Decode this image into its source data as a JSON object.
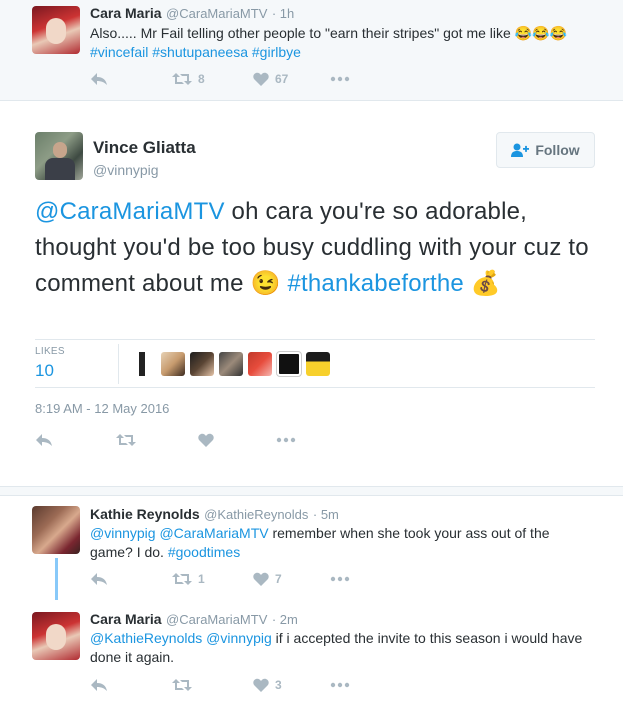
{
  "top_tweet": {
    "name": "Cara Maria",
    "handle": "@CaraMariaMTV",
    "time": "· 1h",
    "text": "Also..... Mr Fail telling other people to \"earn their stripes\" got me like 😂😂😂",
    "hashtags": "#vincefail #shutupaneesa #girlbye",
    "retweets": "8",
    "likes": "67"
  },
  "main_tweet": {
    "name": "Vince Gliatta",
    "handle": "@vinnypig",
    "follow_label": "Follow",
    "mention": "@CaraMariaMTV",
    "text_1": " oh cara you're so adorable, thought you'd be too busy cuddling with your cuz to comment about me ",
    "emoji_wink": "😉",
    "hashtag": "#thankabeforthe",
    "emoji_money": "💰",
    "likes_label": "LIKES",
    "likes_count": "10",
    "timestamp": "8:19 AM - 12 May 2016"
  },
  "reply1": {
    "name": "Kathie Reynolds",
    "handle": "@KathieReynolds",
    "time": "· 5m",
    "mention_1": "@vinnypig",
    "mention_2": "@CaraMariaMTV",
    "text": " remember when she took your ass out of the game? I do. ",
    "hashtag": "#goodtimes",
    "retweets": "1",
    "likes": "7"
  },
  "reply2": {
    "name": "Cara Maria",
    "handle": "@CaraMariaMTV",
    "time": "· 2m",
    "mention_1": "@KathieReynolds",
    "mention_2": "@vinnypig",
    "text": " if i accepted the invite to this season i would have done it again.",
    "likes": "3"
  },
  "colors": {
    "link": "#1b95e0",
    "icon": "#aab8c2",
    "border": "#e1e8ed"
  }
}
